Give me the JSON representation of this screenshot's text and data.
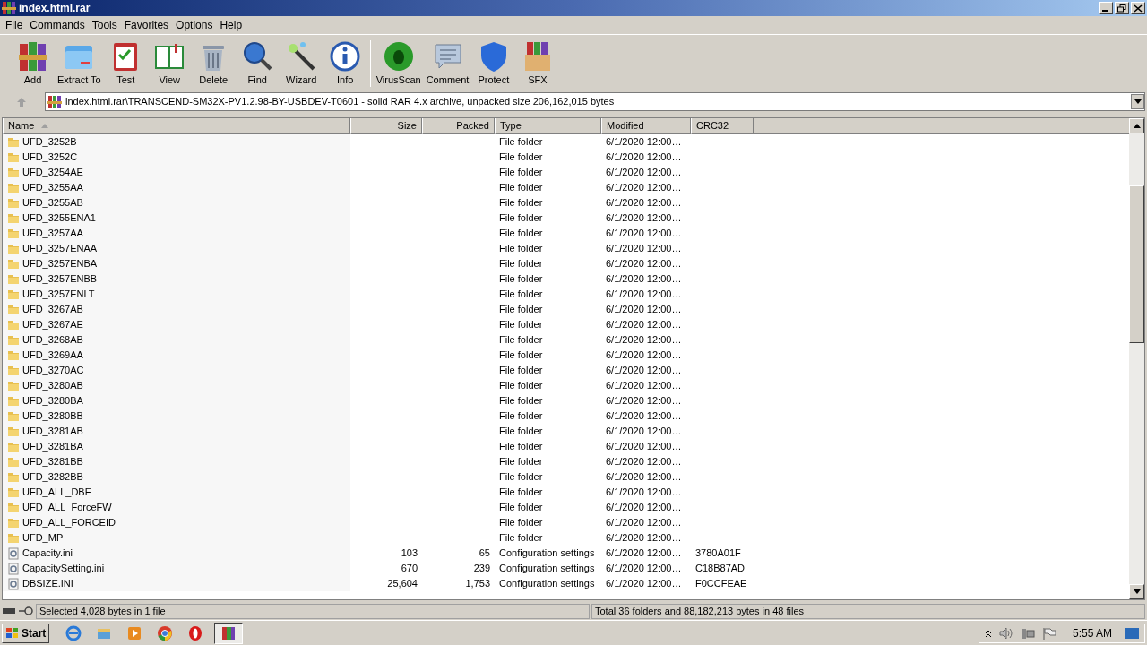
{
  "window": {
    "title": "index.html.rar"
  },
  "menu": [
    "File",
    "Commands",
    "Tools",
    "Favorites",
    "Options",
    "Help"
  ],
  "toolbar": [
    {
      "label": "Add",
      "kind": "add"
    },
    {
      "label": "Extract To",
      "kind": "extract"
    },
    {
      "label": "Test",
      "kind": "test"
    },
    {
      "label": "View",
      "kind": "view"
    },
    {
      "label": "Delete",
      "kind": "delete"
    },
    {
      "label": "Find",
      "kind": "find"
    },
    {
      "label": "Wizard",
      "kind": "wizard"
    },
    {
      "label": "Info",
      "kind": "info"
    },
    {
      "label": "VirusScan",
      "kind": "virus"
    },
    {
      "label": "Comment",
      "kind": "comment"
    },
    {
      "label": "Protect",
      "kind": "protect"
    },
    {
      "label": "SFX",
      "kind": "sfx"
    }
  ],
  "address": "index.html.rar\\TRANSCEND-SM32X-PV1.2.98-BY-USBDEV-T0601 - solid RAR 4.x archive, unpacked size 206,162,015 bytes",
  "table": {
    "columns": [
      "Name",
      "Size",
      "Packed",
      "Type",
      "Modified",
      "CRC32"
    ],
    "rows": [
      {
        "kind": "folder",
        "name": "UFD_3252B",
        "type": "File folder",
        "modified": "6/1/2020 12:00…"
      },
      {
        "kind": "folder",
        "name": "UFD_3252C",
        "type": "File folder",
        "modified": "6/1/2020 12:00…"
      },
      {
        "kind": "folder",
        "name": "UFD_3254AE",
        "type": "File folder",
        "modified": "6/1/2020 12:00…"
      },
      {
        "kind": "folder",
        "name": "UFD_3255AA",
        "type": "File folder",
        "modified": "6/1/2020 12:00…"
      },
      {
        "kind": "folder",
        "name": "UFD_3255AB",
        "type": "File folder",
        "modified": "6/1/2020 12:00…"
      },
      {
        "kind": "folder",
        "name": "UFD_3255ENA1",
        "type": "File folder",
        "modified": "6/1/2020 12:00…"
      },
      {
        "kind": "folder",
        "name": "UFD_3257AA",
        "type": "File folder",
        "modified": "6/1/2020 12:00…"
      },
      {
        "kind": "folder",
        "name": "UFD_3257ENAA",
        "type": "File folder",
        "modified": "6/1/2020 12:00…"
      },
      {
        "kind": "folder",
        "name": "UFD_3257ENBA",
        "type": "File folder",
        "modified": "6/1/2020 12:00…"
      },
      {
        "kind": "folder",
        "name": "UFD_3257ENBB",
        "type": "File folder",
        "modified": "6/1/2020 12:00…"
      },
      {
        "kind": "folder",
        "name": "UFD_3257ENLT",
        "type": "File folder",
        "modified": "6/1/2020 12:00…"
      },
      {
        "kind": "folder",
        "name": "UFD_3267AB",
        "type": "File folder",
        "modified": "6/1/2020 12:00…"
      },
      {
        "kind": "folder",
        "name": "UFD_3267AE",
        "type": "File folder",
        "modified": "6/1/2020 12:00…"
      },
      {
        "kind": "folder",
        "name": "UFD_3268AB",
        "type": "File folder",
        "modified": "6/1/2020 12:00…"
      },
      {
        "kind": "folder",
        "name": "UFD_3269AA",
        "type": "File folder",
        "modified": "6/1/2020 12:00…"
      },
      {
        "kind": "folder",
        "name": "UFD_3270AC",
        "type": "File folder",
        "modified": "6/1/2020 12:00…"
      },
      {
        "kind": "folder",
        "name": "UFD_3280AB",
        "type": "File folder",
        "modified": "6/1/2020 12:00…"
      },
      {
        "kind": "folder",
        "name": "UFD_3280BA",
        "type": "File folder",
        "modified": "6/1/2020 12:00…"
      },
      {
        "kind": "folder",
        "name": "UFD_3280BB",
        "type": "File folder",
        "modified": "6/1/2020 12:00…"
      },
      {
        "kind": "folder",
        "name": "UFD_3281AB",
        "type": "File folder",
        "modified": "6/1/2020 12:00…"
      },
      {
        "kind": "folder",
        "name": "UFD_3281BA",
        "type": "File folder",
        "modified": "6/1/2020 12:00…"
      },
      {
        "kind": "folder",
        "name": "UFD_3281BB",
        "type": "File folder",
        "modified": "6/1/2020 12:00…"
      },
      {
        "kind": "folder",
        "name": "UFD_3282BB",
        "type": "File folder",
        "modified": "6/1/2020 12:00…"
      },
      {
        "kind": "folder",
        "name": "UFD_ALL_DBF",
        "type": "File folder",
        "modified": "6/1/2020 12:00…"
      },
      {
        "kind": "folder",
        "name": "UFD_ALL_ForceFW",
        "type": "File folder",
        "modified": "6/1/2020 12:00…"
      },
      {
        "kind": "folder",
        "name": "UFD_ALL_FORCEID",
        "type": "File folder",
        "modified": "6/1/2020 12:00…"
      },
      {
        "kind": "folder",
        "name": "UFD_MP",
        "type": "File folder",
        "modified": "6/1/2020 12:00…"
      },
      {
        "kind": "file",
        "name": "Capacity.ini",
        "size": "103",
        "packed": "65",
        "type": "Configuration settings",
        "modified": "6/1/2020 12:00…",
        "crc": "3780A01F"
      },
      {
        "kind": "file",
        "name": "CapacitySetting.ini",
        "size": "670",
        "packed": "239",
        "type": "Configuration settings",
        "modified": "6/1/2020 12:00…",
        "crc": "C18B87AD"
      },
      {
        "kind": "file",
        "name": "DBSIZE.INI",
        "size": "25,604",
        "packed": "1,753",
        "type": "Configuration settings",
        "modified": "6/1/2020 12:00…",
        "crc": "F0CCFEAE"
      }
    ]
  },
  "status_bar": {
    "left": "Selected 4,028 bytes in 1 file",
    "right": "Total 36 folders and 88,182,213 bytes in 48 files"
  },
  "taskbar": {
    "start": "Start",
    "apps": [
      {
        "kind": "ie",
        "selected": false
      },
      {
        "kind": "explorer",
        "selected": false
      },
      {
        "kind": "media",
        "selected": false
      },
      {
        "kind": "chrome",
        "selected": false
      },
      {
        "kind": "opera",
        "selected": false
      },
      {
        "kind": "winrar",
        "selected": true
      }
    ],
    "clock": "5:55 AM"
  }
}
